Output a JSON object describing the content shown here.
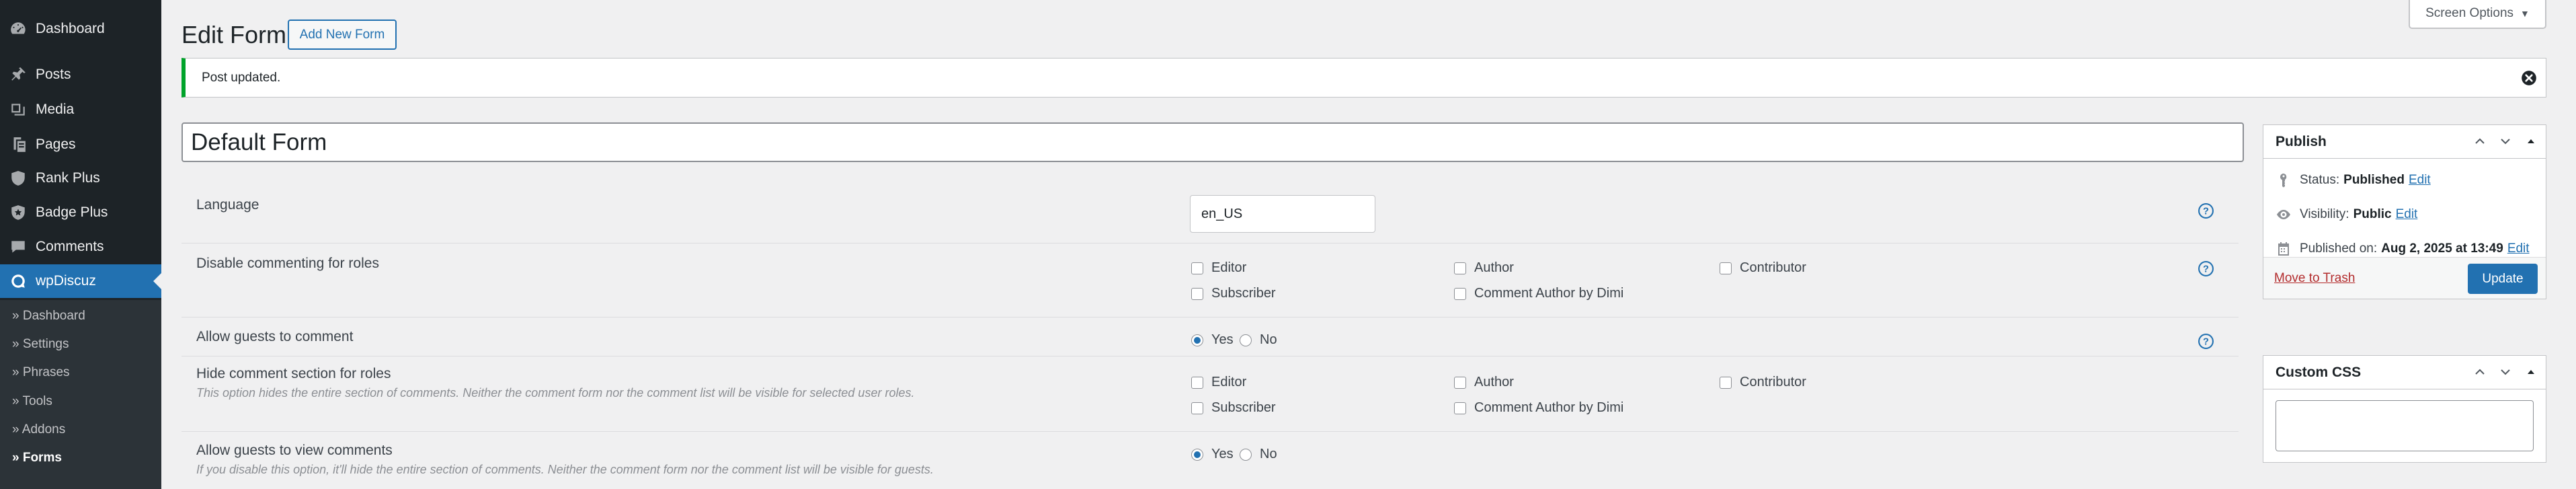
{
  "sidebar": {
    "items": [
      {
        "label": "Dashboard",
        "icon": "dashboard-icon"
      },
      {
        "label": "Posts",
        "icon": "pin-icon"
      },
      {
        "label": "Media",
        "icon": "media-icon"
      },
      {
        "label": "Pages",
        "icon": "pages-icon"
      },
      {
        "label": "Rank Plus",
        "icon": "shield-icon"
      },
      {
        "label": "Badge Plus",
        "icon": "badge-icon"
      },
      {
        "label": "Comments",
        "icon": "comment-icon"
      },
      {
        "label": "wpDiscuz",
        "icon": "discuz-icon"
      }
    ],
    "submenu": [
      "» Dashboard",
      "» Settings",
      "» Phrases",
      "» Tools",
      "» Addons",
      "» Forms"
    ]
  },
  "header": {
    "title": "Edit Form",
    "add_new_label": "Add New Form",
    "screen_options_label": "Screen Options"
  },
  "notice": {
    "text": "Post updated.",
    "color": "#00a32a"
  },
  "form_title": "Default Form",
  "settings": {
    "language": {
      "label": "Language",
      "value": "en_US"
    },
    "disable_commenting": {
      "label": "Disable commenting for roles",
      "options": [
        "Editor",
        "Author",
        "Contributor",
        "Subscriber",
        "Comment Author by Dimi"
      ]
    },
    "guest_comment": {
      "label": "Allow guests to comment",
      "yes": "Yes",
      "no": "No",
      "selected": "Yes"
    },
    "hide_section": {
      "label": "Hide comment section for roles",
      "description": "This option hides the entire section of comments. Neither the comment form nor the comment list will be visible for selected user roles.",
      "options": [
        "Editor",
        "Author",
        "Contributor",
        "Subscriber",
        "Comment Author by Dimi"
      ]
    },
    "guest_view": {
      "label": "Allow guests to view comments",
      "description": "If you disable this option, it'll hide the entire section of comments. Neither the comment form nor the comment list will be visible for guests.",
      "yes": "Yes",
      "no": "No",
      "selected": "Yes"
    }
  },
  "publish": {
    "title": "Publish",
    "status_label": "Status:",
    "status_value": "Published",
    "visibility_label": "Visibility:",
    "visibility_value": "Public",
    "published_label": "Published on:",
    "published_value": "Aug 2, 2025 at 13:49",
    "edit_label": "Edit",
    "trash_label": "Move to Trash",
    "update_label": "Update"
  },
  "custom_css": {
    "title": "Custom CSS"
  },
  "colors": {
    "accent": "#2271b1",
    "sidebar": "#1d2327",
    "success": "#00a32a",
    "danger": "#b32d2e"
  }
}
